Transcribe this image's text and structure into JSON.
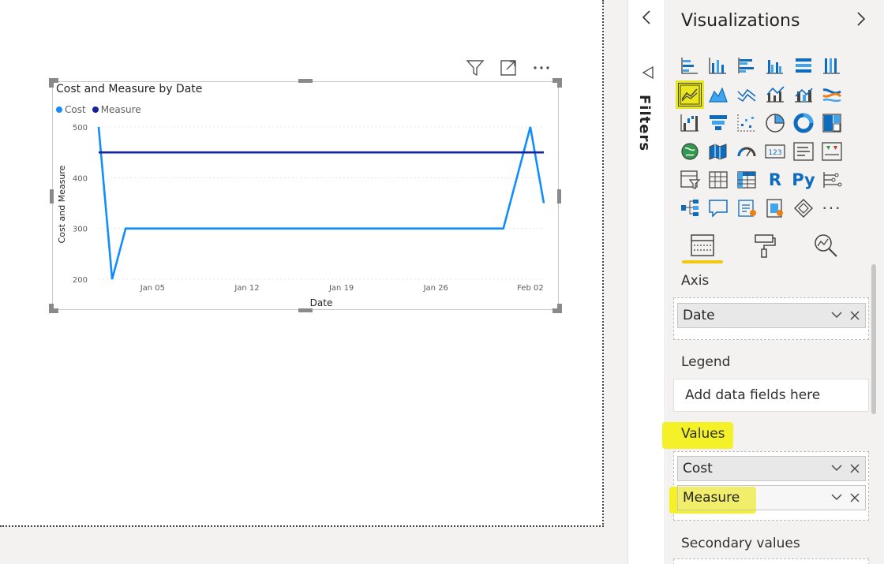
{
  "chart_data": {
    "type": "line",
    "title": "Cost and Measure by Date",
    "xlabel": "Date",
    "ylabel": "Cost and Measure",
    "x_ticks": [
      "Jan 05",
      "Jan 12",
      "Jan 19",
      "Jan 26",
      "Feb 02"
    ],
    "y_ticks": [
      200,
      300,
      400,
      500
    ],
    "ylim": [
      200,
      500
    ],
    "x_range": [
      "2021-01-01",
      "2021-02-03"
    ],
    "legend": "top-left",
    "grid": true,
    "series": [
      {
        "name": "Cost",
        "color": "#118dff",
        "points": [
          {
            "x": "2021-01-01",
            "y": 500
          },
          {
            "x": "2021-01-02",
            "y": 200
          },
          {
            "x": "2021-01-03",
            "y": 300
          },
          {
            "x": "2021-01-31",
            "y": 300
          },
          {
            "x": "2021-02-02",
            "y": 500
          },
          {
            "x": "2021-02-03",
            "y": 350
          }
        ]
      },
      {
        "name": "Measure",
        "color": "#12239e",
        "points": [
          {
            "x": "2021-01-01",
            "y": 450
          },
          {
            "x": "2021-02-03",
            "y": 450
          }
        ]
      }
    ]
  },
  "filters": {
    "label": "Filters"
  },
  "viz_pane": {
    "title": "Visualizations",
    "icons": [
      "stacked-bar-chart-icon",
      "stacked-column-chart-icon",
      "clustered-bar-chart-icon",
      "clustered-column-chart-icon",
      "100-percent-bar-chart-icon",
      "100-percent-column-chart-icon",
      "line-chart-icon",
      "area-chart-icon",
      "stacked-area-chart-icon",
      "line-clustered-column-icon",
      "line-stacked-column-icon",
      "ribbon-chart-icon",
      "waterfall-chart-icon",
      "funnel-chart-icon",
      "scatter-chart-icon",
      "pie-chart-icon",
      "donut-chart-icon",
      "treemap-icon",
      "map-icon",
      "filled-map-icon",
      "gauge-icon",
      "card-icon",
      "multi-row-card-icon",
      "kpi-icon",
      "slicer-icon",
      "table-icon",
      "matrix-icon",
      "r-visual-icon",
      "python-visual-icon",
      "key-influencers-icon",
      "decomposition-tree-icon",
      "qa-icon",
      "smart-narrative-icon",
      "paginated-report-icon",
      "power-apps-icon",
      "more-visuals-icon"
    ],
    "selected_icon": "line-chart-icon",
    "r_label": "R",
    "py_label": "Py",
    "more_label": "···",
    "tabs": [
      "fields-tab-icon",
      "format-tab-icon",
      "analytics-tab-icon"
    ],
    "axis": {
      "label": "Axis",
      "fields": [
        "Date"
      ]
    },
    "legend": {
      "label": "Legend",
      "placeholder": "Add data fields here"
    },
    "values": {
      "label": "Values",
      "fields": [
        "Cost",
        "Measure"
      ]
    },
    "secondary": {
      "label": "Secondary values"
    }
  }
}
